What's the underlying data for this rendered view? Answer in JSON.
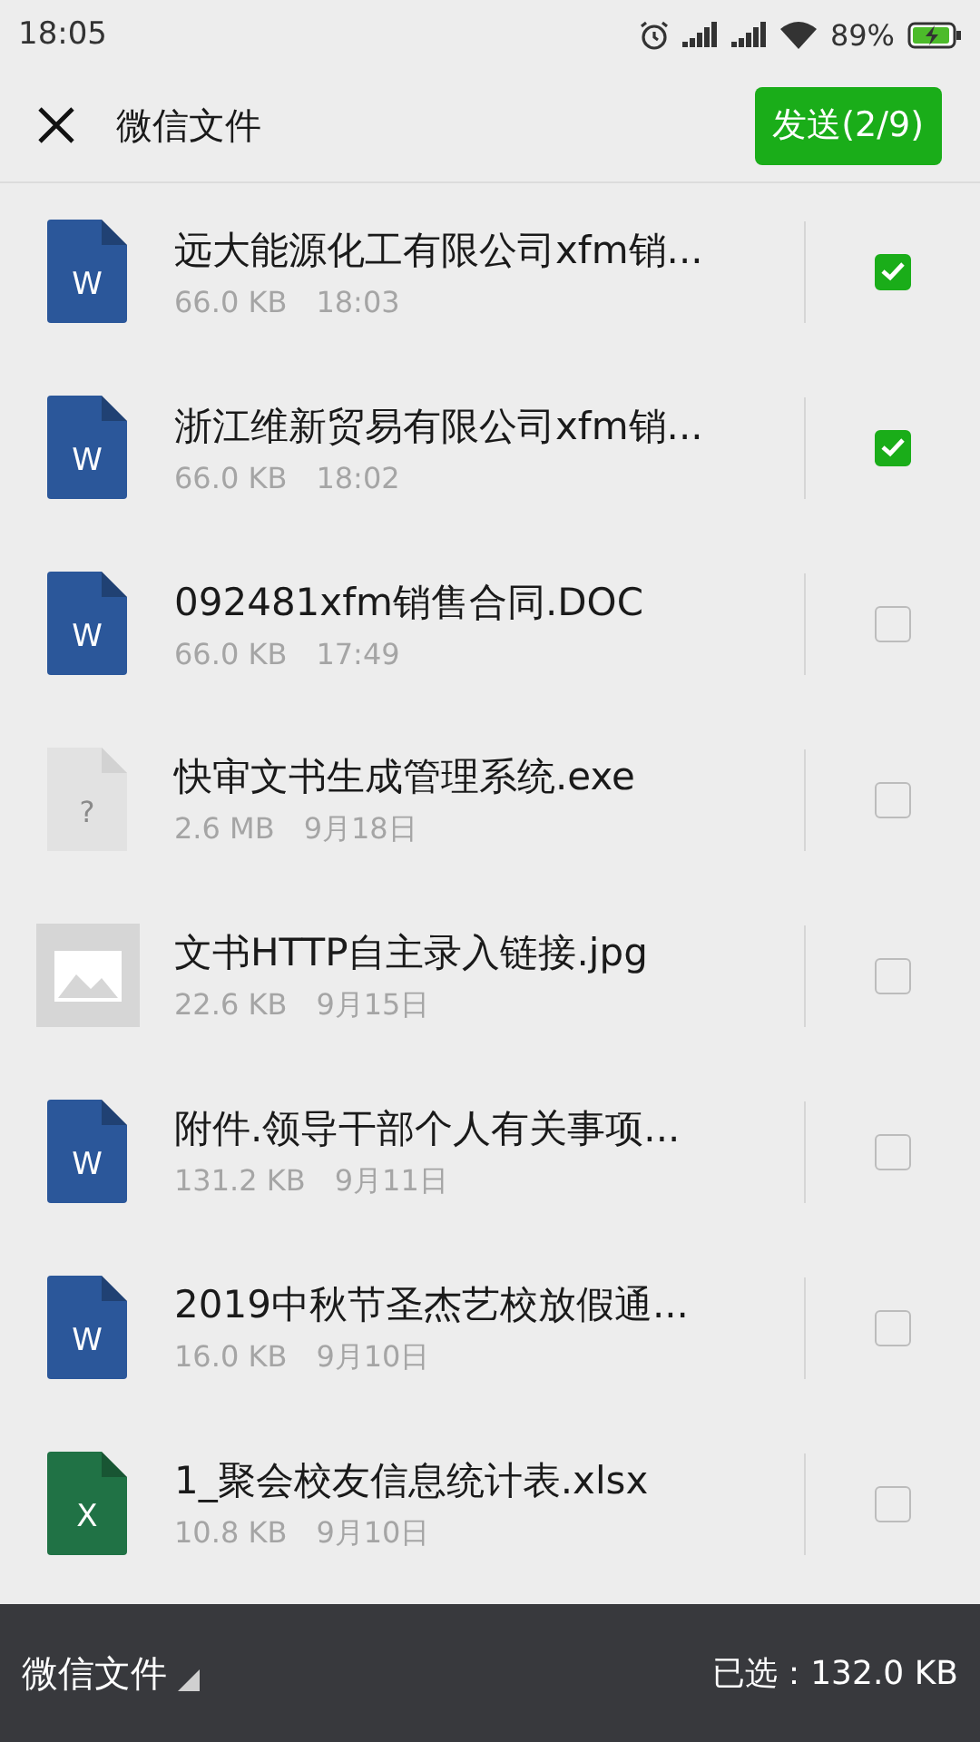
{
  "status_bar": {
    "time": "18:05",
    "battery": "89%"
  },
  "header": {
    "title": "微信文件",
    "send_button": "发送(2/9)"
  },
  "files": [
    {
      "kind": "word",
      "icon_label": "W",
      "name": "远大能源化工有限公司xfm销...",
      "size": "66.0 KB",
      "date": "18:03",
      "checked": true
    },
    {
      "kind": "word",
      "icon_label": "W",
      "name": "浙江维新贸易有限公司xfm销...",
      "size": "66.0 KB",
      "date": "18:02",
      "checked": true
    },
    {
      "kind": "word",
      "icon_label": "W",
      "name": "092481xfm销售合同.DOC",
      "size": "66.0 KB",
      "date": "17:49",
      "checked": false
    },
    {
      "kind": "unknown",
      "icon_label": "?",
      "name": "快审文书生成管理系统.exe",
      "size": "2.6 MB",
      "date": "9月18日",
      "checked": false
    },
    {
      "kind": "image",
      "name": "文书HTTP自主录入链接.jpg",
      "size": "22.6 KB",
      "date": "9月15日",
      "checked": false
    },
    {
      "kind": "word",
      "icon_label": "W",
      "name": "附件.领导干部个人有关事项...",
      "size": "131.2 KB",
      "date": "9月11日",
      "checked": false
    },
    {
      "kind": "word",
      "icon_label": "W",
      "name": "2019中秋节圣杰艺校放假通...",
      "size": "16.0 KB",
      "date": "9月10日",
      "checked": false
    },
    {
      "kind": "excel",
      "icon_label": "X",
      "name": "1_聚会校友信息统计表.xlsx",
      "size": "10.8 KB",
      "date": "9月10日",
      "checked": false
    }
  ],
  "footer": {
    "source": "微信文件",
    "selected_size": "已选：132.0 KB"
  }
}
